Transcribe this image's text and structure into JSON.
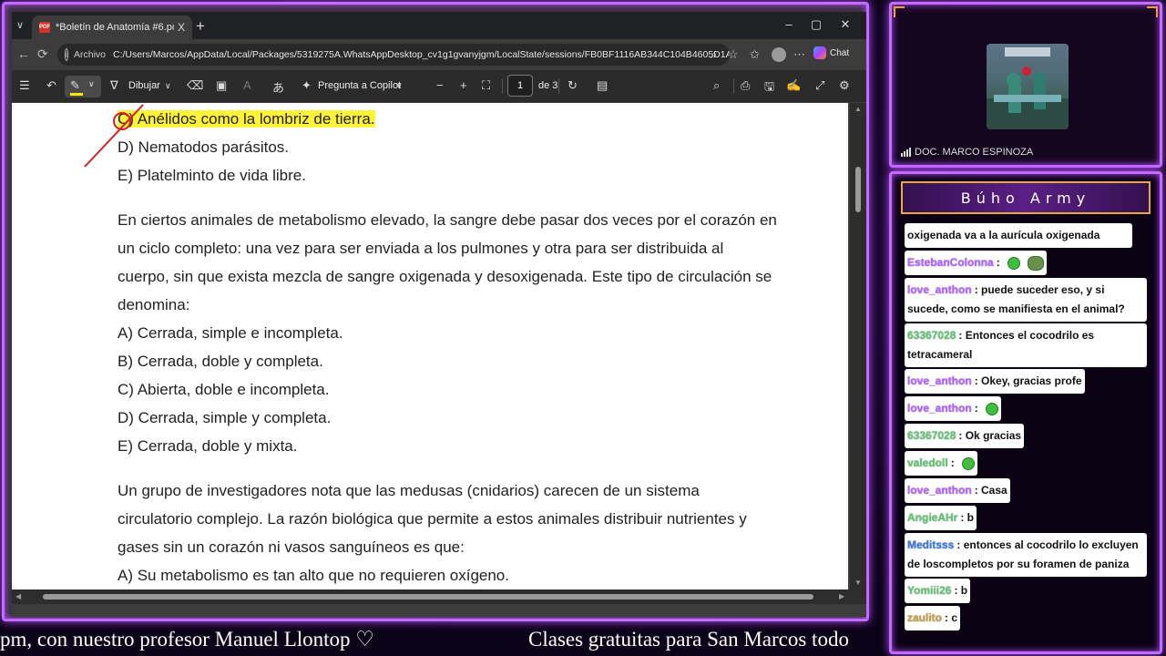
{
  "browser": {
    "tab_title": "*Boletín de Anatomía #6.pdf",
    "tab_close": "X",
    "new_tab": "+",
    "tab_dropdown": "∨",
    "win_minimize": "–",
    "win_maximize": "▢",
    "win_close": "✕",
    "address": {
      "scheme_label": "Archivo",
      "url": "C:/Users/Marcos/AppData/Local/Packages/5319275A.WhatsAppDesktop_cv1g1gvanyjgm/LocalState/sessions/FB0BF1116AB344C104B4605D1AB39C91...",
      "chat_label": "Chat"
    }
  },
  "pdf_toolbar": {
    "draw_label": "Dibujar",
    "copilot_label": "Pregunta a Copilot",
    "page_current": "1",
    "page_total": "de 3"
  },
  "document": {
    "lines": [
      {
        "text": "C) Anélidos como la lombriz de tierra.",
        "highlighted": true
      },
      {
        "text": "D) Nematodos parásitos."
      },
      {
        "text": "E) Platelminto de vida libre."
      },
      {
        "text": "En ciertos animales de metabolismo elevado, la sangre debe pasar dos veces por el corazón en"
      },
      {
        "text": "un ciclo completo: una vez para ser enviada a los pulmones y otra para ser distribuida al"
      },
      {
        "text": "cuerpo, sin que exista mezcla de sangre oxigenada y desoxigenada. Este tipo de circulación se"
      },
      {
        "text": "denomina:"
      },
      {
        "text": "A) Cerrada, simple e incompleta."
      },
      {
        "text": "B) Cerrada, doble y completa."
      },
      {
        "text": "C) Abierta, doble e incompleta."
      },
      {
        "text": "D) Cerrada, simple y completa."
      },
      {
        "text": "E) Cerrada, doble y mixta."
      },
      {
        "text": "Un grupo de investigadores nota que las medusas (cnidarios) carecen de un sistema"
      },
      {
        "text": "circulatorio complejo. La razón biológica que permite a estos animales distribuir nutrientes y"
      },
      {
        "text": "gases sin un corazón ni vasos sanguíneos es que:"
      },
      {
        "text": "A) Su metabolismo es tan alto que no requieren oxígeno."
      }
    ],
    "annotation_color": "#d42020",
    "highlight_color": "#fff33a"
  },
  "ticker": {
    "left_text": "pm, con nuestro profesor Manuel Llontop ♡",
    "right_text": "Clases gratuitas para San Marcos todo"
  },
  "webcam": {
    "name": "DOC. MARCO ESPINOZA"
  },
  "chat": {
    "title": "Búho Army",
    "messages": [
      {
        "user": "",
        "text": "oxigenada va a la aurícula oxigenada"
      },
      {
        "user": "EstebanColonna",
        "text": ":",
        "emotes": [
          "frog",
          "frog2"
        ]
      },
      {
        "user": "love_anthon",
        "text": ": puede suceder eso, y si",
        "text2": "sucede, como se manifiesta en el animal?"
      },
      {
        "user": "63367028",
        "text": ": Entonces el cocodrilo es",
        "text2": "tetracameral"
      },
      {
        "user": "love_anthon",
        "text": ": Okey, gracias profe"
      },
      {
        "user": "love_anthon",
        "text": ":",
        "emotes": [
          "frog"
        ]
      },
      {
        "user": "63367028",
        "text": ": Ok gracias"
      },
      {
        "user": "valedoll",
        "text": ":",
        "emotes": [
          "frog"
        ]
      },
      {
        "user": "love_anthon",
        "text": ": Casa"
      },
      {
        "user": "AngieAHr",
        "text": ": b"
      },
      {
        "user": "Meditsss",
        "text": ": entonces al cocodrilo lo excluyen",
        "text2": "de loscompletos por su foramen de paniza"
      },
      {
        "user": "Yomiii26",
        "text": ": b"
      },
      {
        "user": "zaulito",
        "text": ": c"
      }
    ]
  },
  "colors": {
    "neon": "#c46bff",
    "accent_gold": "#e8a93a"
  }
}
